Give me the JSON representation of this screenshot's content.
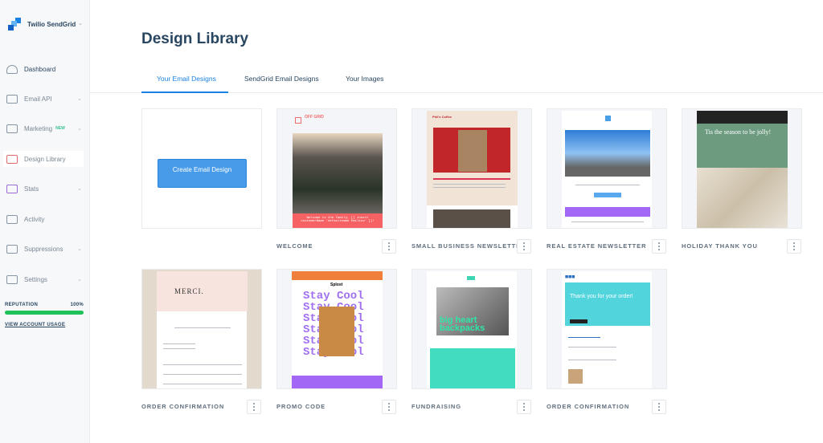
{
  "sidebar": {
    "brand": "Twilio SendGrid",
    "items": [
      {
        "label": "Dashboard",
        "icon": "gauge-icon",
        "has_chevron": false
      },
      {
        "label": "Email API",
        "icon": "code-window-icon",
        "has_chevron": true
      },
      {
        "label": "Marketing",
        "icon": "megaphone-icon",
        "has_chevron": true,
        "badge": "NEW"
      },
      {
        "label": "Design Library",
        "icon": "pencil-ruler-icon",
        "has_chevron": false
      },
      {
        "label": "Stats",
        "icon": "bar-chart-icon",
        "has_chevron": true
      },
      {
        "label": "Activity",
        "icon": "mail-search-icon",
        "has_chevron": false
      },
      {
        "label": "Suppressions",
        "icon": "mail-block-icon",
        "has_chevron": true
      },
      {
        "label": "Settings",
        "icon": "sliders-icon",
        "has_chevron": true
      }
    ],
    "reputation_label": "REPUTATION",
    "reputation_value": "100%",
    "reputation_percent": 100,
    "usage_link": "VIEW ACCOUNT USAGE"
  },
  "page": {
    "title": "Design Library"
  },
  "tabs": [
    {
      "label": "Your Email Designs",
      "active": true
    },
    {
      "label": "SendGrid Email Designs"
    },
    {
      "label": "Your Images"
    }
  ],
  "create_button": "Create Email Design",
  "designs": [
    {
      "name": "WELCOME",
      "thumb_text": "Welcome to the family, [[ insert customerName 'defaultname Emilios' ]]!",
      "brand": "OFF GRID"
    },
    {
      "name": "SMALL BUSINESS NEWSLETTER",
      "brand": "Phil's Coffee"
    },
    {
      "name": "REAL ESTATE NEWSLETTER"
    },
    {
      "name": "HOLIDAY THANK YOU",
      "thumb_text": "Tis the season to be jolly!"
    },
    {
      "name": "ORDER CONFIRMATION",
      "thumb_text": "MERCI."
    },
    {
      "name": "PROMO CODE",
      "thumb_text": "Stay Cool",
      "brand": "Splost"
    },
    {
      "name": "FUNDRAISING",
      "thumb_text": "big heart backpacks"
    },
    {
      "name": "ORDER CONFIRMATION",
      "thumb_text": "Thank you for your order!"
    }
  ],
  "colors": {
    "accent": "#1a82e2",
    "heading": "#294661",
    "reputation": "#1ec15a"
  }
}
